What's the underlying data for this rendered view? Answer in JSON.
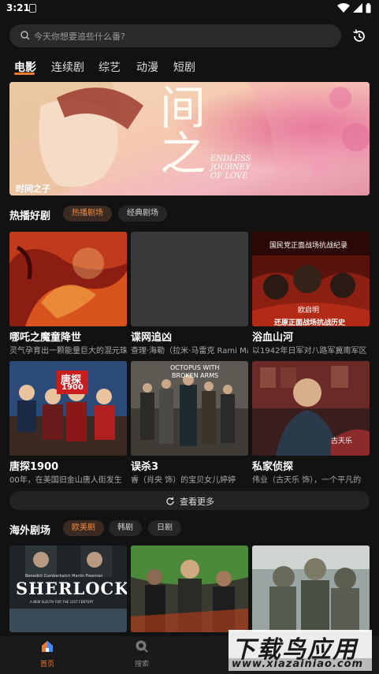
{
  "status": {
    "time": "3:21"
  },
  "search": {
    "placeholder": "今天你想要追些什么番?"
  },
  "tabs": [
    {
      "label": "电影",
      "active": true
    },
    {
      "label": "连续剧",
      "active": false
    },
    {
      "label": "综艺",
      "active": false
    },
    {
      "label": "动漫",
      "active": false
    },
    {
      "label": "短剧",
      "active": false
    }
  ],
  "banner": {
    "caption": "时间之子",
    "title_art": "间之",
    "subtitle_art": [
      "ENDLESS",
      "JOURNEY",
      "OF LOVE"
    ]
  },
  "hot": {
    "title": "热播好剧",
    "chips": [
      "热播剧场",
      "经典剧场"
    ],
    "cards": [
      {
        "title": "哪吒之魔童降世",
        "desc": "灵气孕育出一颗能量巨大的混元珠"
      },
      {
        "title": "谍网追凶",
        "desc": "查理·海勒（拉米·马雷克 Rami Malek）"
      },
      {
        "title": "浴血山河",
        "desc": "以1942年日军对八路军冀南军区"
      },
      {
        "title": "唐探1900",
        "desc": "00年，在美国旧金山唐人街发生"
      },
      {
        "title": "误杀3",
        "desc": "睿（肖央 饰）的宝贝女儿婷婷"
      },
      {
        "title": "私家侦探",
        "desc": "伟业（古天乐 饰），一个平凡的"
      }
    ],
    "poster_text": {
      "c3_top": "国民党正面战场抗战纪录",
      "c3_name": "欧启明",
      "c3_bottom": "还原正面战场抗战历史",
      "c4_box": "唐探",
      "c4_num": "1900",
      "c5_line1": "OCTOPUS WITH",
      "c5_line2": "BROKEN ARMS",
      "c6_name": "古天乐"
    },
    "more_label": "查看更多"
  },
  "overseas": {
    "title": "海外剧场",
    "chips": [
      "欧美剧",
      "韩剧",
      "日剧"
    ],
    "poster1_title": "SHERLOCK",
    "poster1_names": "Benedict Cumberbatch    Martin Freeman",
    "poster1_tagline": "A NEW SLEUTH FOR THE 21ST CENTURY"
  },
  "nav": {
    "home": "首页",
    "search": "搜索"
  },
  "watermark": {
    "main": "下载鸟应用",
    "url": "www.xiazainiao.com"
  },
  "colors": {
    "accent": "#f07a30",
    "background": "#121212",
    "chip_active_bg": "#3b2a22"
  }
}
